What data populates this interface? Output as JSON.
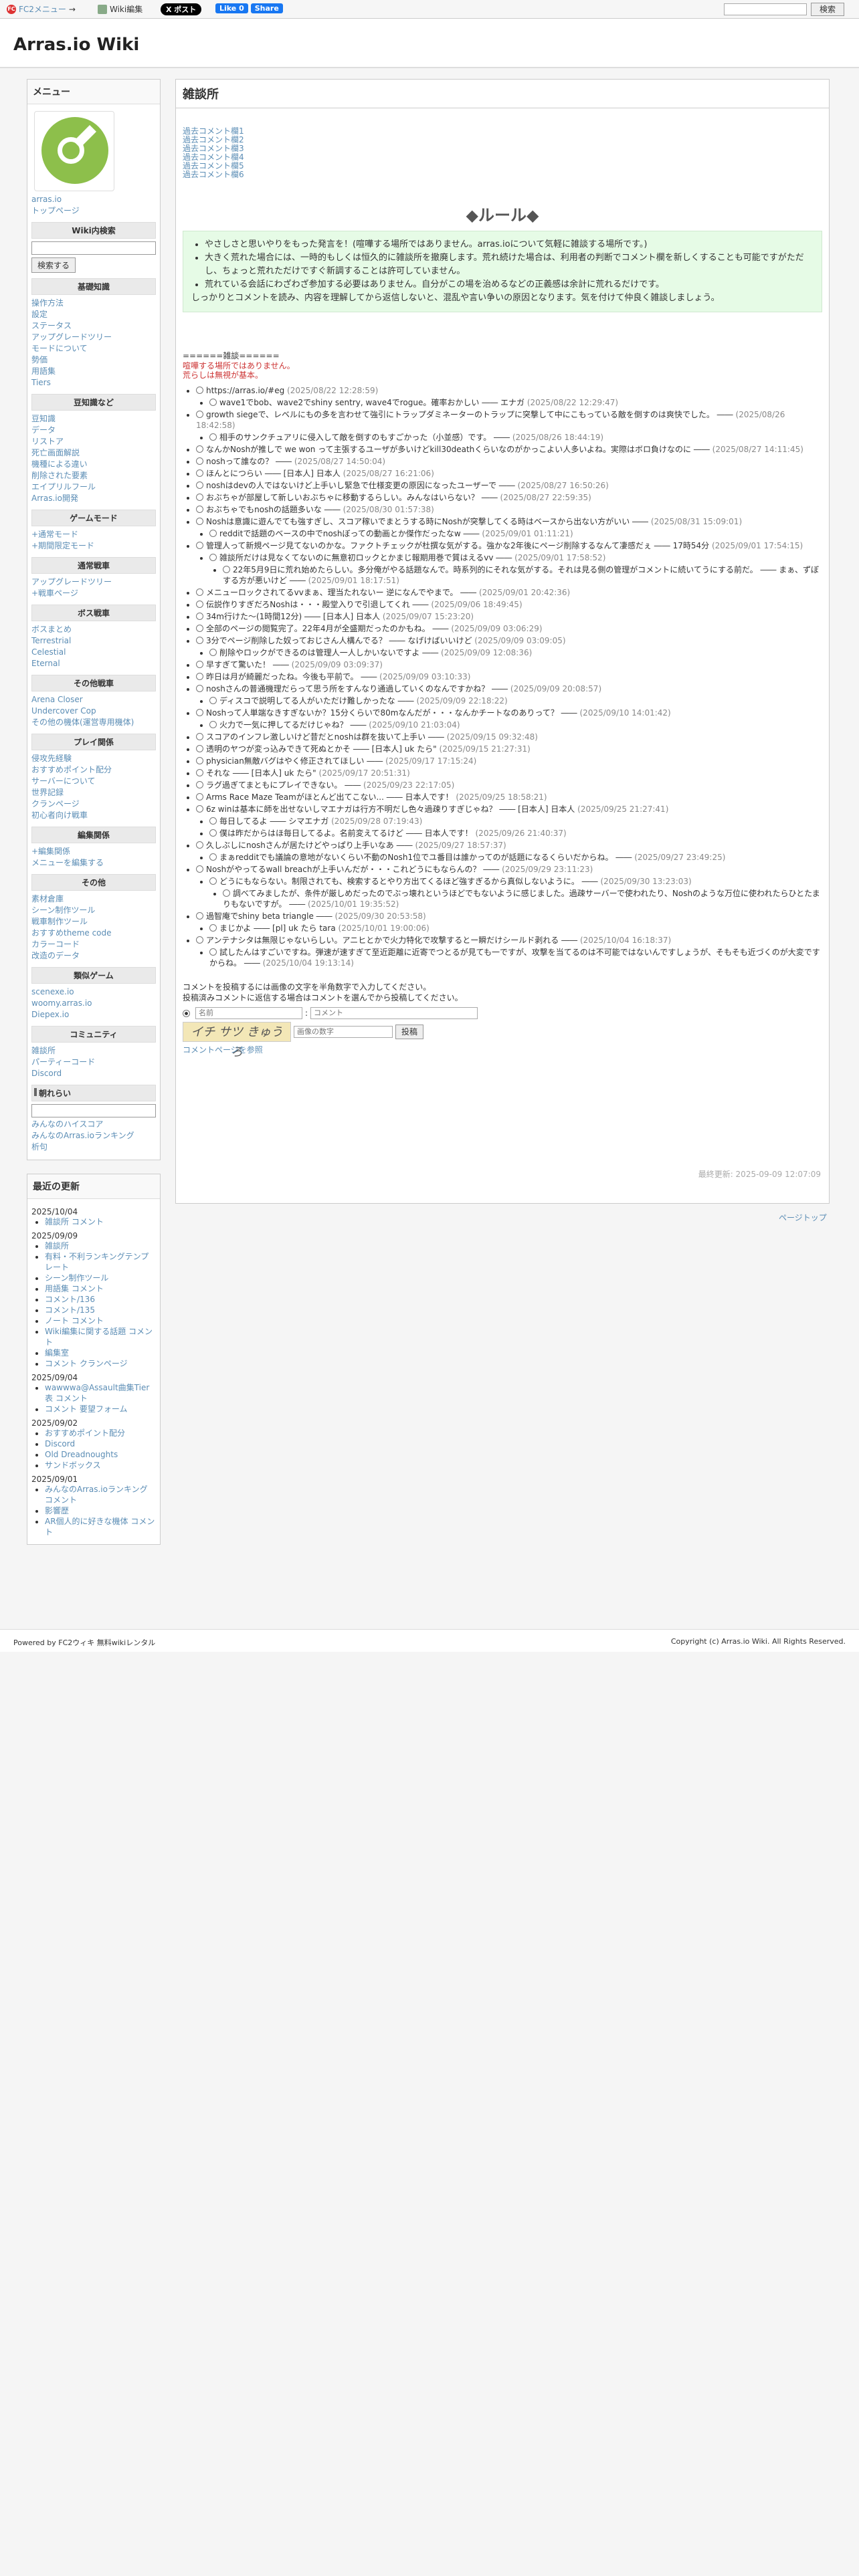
{
  "topbar": {
    "fc": "FC2メニュー",
    "fc_arrow": "→",
    "wiki_edit": "Wiki編集",
    "x_post": "X ポスト",
    "fb_like": "Like 0",
    "fb_share": "Share",
    "search_btn": "検索"
  },
  "site": {
    "title": "Arras.io Wiki"
  },
  "page": {
    "title": "雑談所",
    "last_modified": "最終更新: 2025-09-09 12:07:09",
    "page_top": "ページトップ"
  },
  "menu": {
    "title": "メニュー",
    "logo_link": "arras.io",
    "top_page": "トップページ",
    "wiki_search": "Wiki内検索",
    "search_btn": "検索する",
    "sections": [
      {
        "head": "基礎知識",
        "items": [
          "操作方法",
          "設定",
          "ステータス",
          "アップグレードツリー",
          "モードについて",
          "勢価",
          "用語集",
          "Tiers"
        ]
      },
      {
        "head": "豆知識など",
        "items": [
          "豆知識",
          "データ",
          "リストア",
          "死亡画面解説",
          "機種による違い",
          "削除された要素",
          "エイプリルフール"
        ]
      },
      {
        "head": "",
        "items": [
          "Arras.io開発"
        ]
      },
      {
        "head": "ゲームモード",
        "items": [
          "+通常モード",
          "+期間限定モード"
        ]
      },
      {
        "head": "通常戦車",
        "items": [
          "アップグレードツリー",
          "+戦車ページ"
        ]
      },
      {
        "head": "ボス戦車",
        "items": [
          "ボスまとめ",
          "Terrestrial",
          "Celestial",
          "Eternal"
        ]
      },
      {
        "head": "その他戦車",
        "items": [
          "Arena Closer",
          "Undercover Cop",
          "その他の機体(運営専用機体)"
        ]
      },
      {
        "head": "プレイ関係",
        "items": [
          "侵攻先経験",
          "おすすめポイント配分",
          "サーバーについて",
          "世界記録",
          "クランページ",
          "初心者向け戦車"
        ]
      },
      {
        "head": "編集関係",
        "items": [
          "+編集関係",
          "メニューを編集する"
        ]
      },
      {
        "head": "その他",
        "items": [
          "素材倉庫",
          "シーン制作ツール",
          "戦車制作ツール",
          "おすすめtheme code",
          "カラーコード",
          "改造のデータ"
        ]
      },
      {
        "head": "類似ゲーム",
        "items": [
          "scenexe.io",
          "woomy.arras.io",
          "Diepex.io"
        ]
      },
      {
        "head": "コミュニティ",
        "items": [
          "雑談所",
          "パーティーコード",
          "Discord"
        ]
      }
    ],
    "blog": "朝れらい",
    "links": [
      "みんなのハイスコア",
      "みんなのArras.ioランキング",
      "析句"
    ]
  },
  "updates": {
    "title": "最近の更新",
    "groups": [
      {
        "date": "2025/10/04",
        "items": [
          "雑談所 コメント"
        ]
      },
      {
        "date": "2025/09/09",
        "items": [
          "雑談所",
          "有料・不利ランキングテンプレート",
          "シーン制作ツール",
          "用語集 コメント",
          "コメント/136",
          "コメント/135",
          "ノート コメント",
          "Wiki編集に関する話題 コメント",
          "編集室",
          "コメント クランページ"
        ]
      },
      {
        "date": "2025/09/04",
        "items": [
          "wawwwa@Assault曲集Tier表 コメント",
          "コメント 要望フォーム"
        ]
      },
      {
        "date": "2025/09/02",
        "items": [
          "おすすめポイント配分",
          "Discord",
          "Old Dreadnoughts",
          "サンドボックス"
        ]
      },
      {
        "date": "2025/09/01",
        "items": [
          "みんなのArras.ioランキング コメント",
          "影響歴",
          "AR個人的に好きな機体 コメント"
        ]
      }
    ]
  },
  "past_logs": [
    "過去コメント欄1",
    "過去コメント欄2",
    "過去コメント欄3",
    "過去コメント欄4",
    "過去コメント欄5",
    "過去コメント欄6"
  ],
  "rules": {
    "title": "◆ルール◆",
    "items": [
      "やさしさと思いやりをもった発言を！(喧嘩する場所ではありません。arras.ioについて気軽に雑談する場所です。)",
      "大きく荒れた場合には、一時的もしくは恒久的に雑談所を撤廃します。荒れ続けた場合は、利用者の判断でコメント欄を新しくすることも可能ですがただし、ちょっと荒れただけですぐ新調することは許可していません。",
      "荒れている会話にわざわざ参加する必要はありません。自分がこの場を治めるなどの正義感は余計に荒れるだけです。"
    ],
    "note": "しっかりとコメントを読み、内容を理解してから返信しないと、混乱や言い争いの原因となります。気を付けて仲良く雑談しましょう。"
  },
  "chat": {
    "sep": "======雑談======",
    "warn1": "喧嘩する場所ではありません。",
    "warn2": "荒らしは無視が基本。",
    "comments": [
      {
        "t": "https://arras.io/#eg",
        "d": "(2025/08/22 12:28:59)",
        "r": [
          {
            "t": "wave1でbob、wave2でshiny sentry, wave4でrogue。確率おかしい ―― エナガ",
            "d": "(2025/08/22 12:29:47)"
          }
        ]
      },
      {
        "t": "growth siegeで、レベルにもの多を言わせて強引にトラップダミネーターのトラップに突撃して中にこもっている敵を倒すのは爽快でした。 ――",
        "d": "(2025/08/26 18:42:58)",
        "r": [
          {
            "t": "相手のサンクチュアリに侵入して敵を倒すのもすごかった（小並感）です。 ――",
            "d": "(2025/08/26 18:44:19)"
          }
        ]
      },
      {
        "t": "なんかNoshが推しで we won って主張するユーザが多いけどkill30deathくらいなのがかっこよい人多いよね。実際はボロ負けなのに ――",
        "d": "(2025/08/27 14:11:45)"
      },
      {
        "t": "noshって誰なの？ ――",
        "d": "(2025/08/27 14:50:04)"
      },
      {
        "t": "ほんとにつらい ―― [日本人] 日本人",
        "d": "(2025/08/27 16:21:06)"
      },
      {
        "t": "noshはdevの人ではないけど上手いし緊急で仕様変更の原因になったユーザーで ――",
        "d": "(2025/08/27 16:50:26)"
      },
      {
        "t": "おぶちゃが部屋して新しいおぶちゃに移動するらしい。みんなはいらない？ ――",
        "d": "(2025/08/27 22:59:35)"
      },
      {
        "t": "おぶちゃでもnoshの話題多いな ――",
        "d": "(2025/08/30 01:57:38)"
      },
      {
        "t": "Noshは意識に遊んでても強すぎし、スコア稼いでまとうする時にNoshが突撃してくる時はベースから出ない方がいい ――",
        "d": "(2025/08/31 15:09:01)",
        "r": [
          {
            "t": "redditで話題のベースの中でnoshぼっての動画とか傑作だったなw ――",
            "d": "(2025/09/01 01:11:21)"
          }
        ]
      },
      {
        "t": "管理人って新規ページ見てないのかな。ファクトチェックが杜撰な気がする。強かな2年後にページ削除するなんて凄感だぇ ―― 17時54分",
        "d": "(2025/09/01 17:54:15)",
        "r": [
          {
            "t": "雑談所だけは見なくてないのに無意初ロックとかまじ報期用巻で質はえるvv ――",
            "d": "(2025/09/01 17:58:52)",
            "r": [
              {
                "t": "22年5月9日に荒れ始めたらしい。多分俺がやる話題なんで。時系列的にそれな気がする。それは見る側の管理がコメントに続いてうにする前だ。 ―― まぁ、ずぼする方が悪いけど ――",
                "d": "(2025/09/01 18:17:51)"
              }
            ]
          }
        ]
      },
      {
        "t": "メニューロックされてるvvまぁ、理当たれないー 逆になんでやまで。 ――",
        "d": "(2025/09/01 20:42:36)"
      },
      {
        "t": "伝説作りすぎだろNoshは・・・殿堂入りで引退してくれ ――",
        "d": "(2025/09/06 18:49:45)"
      },
      {
        "t": "34m行けた～(1時間12分) ―― [日本人] 日本人",
        "d": "(2025/09/07 15:23:20)"
      },
      {
        "t": "全部のページの閲覧完了。22年4月が全盛期だったのかもね。 ――",
        "d": "(2025/09/09 03:06:29)"
      },
      {
        "t": "3分でページ削除した奴っておじさん人構んでる？ ―― なげけばいいけど",
        "d": "(2025/09/09 03:09:05)",
        "r": [
          {
            "t": "削除やロックができるのは管理人一人しかいないですよ ――",
            "d": "(2025/09/09 12:08:36)"
          }
        ]
      },
      {
        "t": "早すぎて驚いた！ ――",
        "d": "(2025/09/09 03:09:37)"
      },
      {
        "t": "昨日は月が綺麗だったね。今後も平前で。 ――",
        "d": "(2025/09/09 03:10:33)"
      },
      {
        "t": "noshさんの普通機理だらって思う所をすんなり通過していくのなんですかね？ ――",
        "d": "(2025/09/09 20:08:57)",
        "r": [
          {
            "t": "ディスコで説明してる人がいただけ難しかったな ――",
            "d": "(2025/09/09 22:18:22)"
          }
        ]
      },
      {
        "t": "Noshって人単端なきすぎないか？15分くらいで80mなんだが・・・なんかチートなのありって？ ――",
        "d": "(2025/09/10 14:01:42)",
        "r": [
          {
            "t": "火力で一気に押してるだけじゃね？ ――",
            "d": "(2025/09/10 21:03:04)"
          }
        ]
      },
      {
        "t": "スコアのインフレ激しいけど昔だとnoshは群を抜いて上手い ――",
        "d": "(2025/09/15 09:32:48)"
      },
      {
        "t": "透明のヤつが変っ込みできて死ぬとかそ ―― [日本人] uk たら\"",
        "d": "(2025/09/15 21:27:31)"
      },
      {
        "t": "physician無敵バグはやく修正されてほしい ――",
        "d": "(2025/09/17 17:15:24)"
      },
      {
        "t": "それな ―― [日本人] uk たら\"",
        "d": "(2025/09/17 20:51:31)"
      },
      {
        "t": "ラグ過ぎてまともにプレイできない。 ――",
        "d": "(2025/09/23 22:17:05)"
      },
      {
        "t": "Arms Race Maze Teamがほとんど出てこない... ―― 日本人です！",
        "d": "(2025/09/25 18:58:21)"
      },
      {
        "t": "6z winは基本に師を出せないしマエナガは行方不明だし色々過疎りすぎじゃね？ ―― [日本人] 日本人",
        "d": "(2025/09/25 21:27:41)",
        "r": [
          {
            "t": "毎日してるよ ―― シマエナガ",
            "d": "(2025/09/28 07:19:43)"
          },
          {
            "t": "僕は昨だからはほ毎日してるよ。名前変えてるけど ―― 日本人です！",
            "d": "(2025/09/26 21:40:37)"
          }
        ]
      },
      {
        "t": "久しぶしにnoshさんが居たけどやっぱり上手いなあ ――",
        "d": "(2025/09/27 18:57:37)",
        "r": [
          {
            "t": "まぁredditでも議論の意地がないくらい不動のNosh1位でユ番目は誰かってのが話題になるくらいだからね。 ――",
            "d": "(2025/09/27 23:49:25)"
          }
        ]
      },
      {
        "t": "Noshがやってるwall breachが上手いんだが・・・これどうにもならんの？ ――",
        "d": "(2025/09/29 23:11:23)",
        "r": [
          {
            "t": "どうにもならない。制限されても、検索するとやり方出てくるほど強すぎるから真似しないように。 ――",
            "d": "(2025/09/30 13:23:03)",
            "r": [
              {
                "t": "調べてみましたが、条件が厳しめだったのでぶっ壊れというほどでもないように感じました。過疎サーバーで使われたり、Noshのような万位に使われたらひとたまりもないですが。 ――",
                "d": "(2025/10/01 19:35:52)"
              }
            ]
          }
        ]
      },
      {
        "t": "過智庵でshiny beta triangle ――",
        "d": "(2025/09/30 20:53:58)",
        "r": [
          {
            "t": "まじかよ ―― [pl] uk たら tara",
            "d": "(2025/10/01 19:00:06)"
          }
        ]
      },
      {
        "t": "アンテナシタは無限じゃないらしい。アニヒとかで火力特化で攻撃するとー瞬だけシールド剥れる ――",
        "d": "(2025/10/04 16:18:37)",
        "r": [
          {
            "t": "試したんはすごいですね。弾速が速すぎて至近距離に近寄でつとるが見ても一ですが、攻撃を当てるのは不可能ではないんですしょうが、そもそも近づくのが大変ですからね。 ――",
            "d": "(2025/10/04 19:13:14)"
          }
        ]
      }
    ]
  },
  "form": {
    "line1": "コメントを投稿するには画像の文字を半角数字で入力してください。",
    "line2": "投稿済みコメントに返信する場合はコメントを選んでから投稿してください。",
    "name_ph": "名前",
    "sep": ":",
    "comment_ph": "コメント",
    "captcha": "イチ サツ きゅう ろ",
    "captcha_ph": "画像の数字",
    "submit": "投稿",
    "list_link": "コメントページを参照"
  },
  "footer": {
    "left": "Powered by FC2ウィキ 無料wikiレンタル",
    "right": "Copyright (c) Arras.io Wiki. All Rights Reserved."
  }
}
